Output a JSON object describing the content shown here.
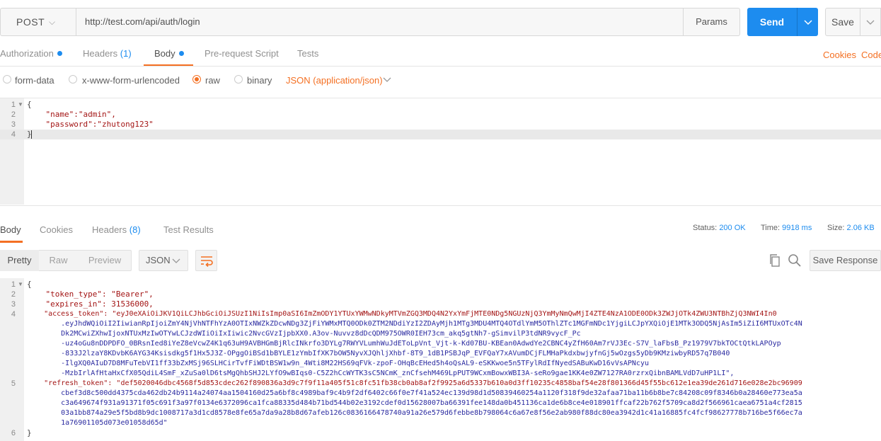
{
  "request": {
    "method": "POST",
    "url": "http://test.com/api/auth/login",
    "params_label": "Params",
    "send_label": "Send",
    "save_label": "Save"
  },
  "request_tabs": [
    {
      "label": "Authorization",
      "dot": true
    },
    {
      "label": "Headers",
      "count": "(1)"
    },
    {
      "label": "Body",
      "dot": true,
      "active": true
    },
    {
      "label": "Pre-request Script"
    },
    {
      "label": "Tests"
    }
  ],
  "links": {
    "cookies": "Cookies",
    "code": "Code"
  },
  "body_types": [
    {
      "label": "form-data",
      "selected": false
    },
    {
      "label": "x-www-form-urlencoded",
      "selected": false
    },
    {
      "label": "raw",
      "selected": true
    },
    {
      "label": "binary",
      "selected": false
    }
  ],
  "raw_format": "JSON (application/json)",
  "request_body": {
    "line_numbers": [
      "1",
      "2",
      "3",
      "4"
    ],
    "lines": [
      "{",
      "    \"name\":\"admin\",",
      "    \"password\":\"zhutong123\"",
      "}"
    ]
  },
  "response_tabs": [
    {
      "label": "Body",
      "active": true
    },
    {
      "label": "Cookies"
    },
    {
      "label": "Headers",
      "count": "(8)"
    },
    {
      "label": "Test Results"
    }
  ],
  "response_meta": {
    "status_label": "Status:",
    "status_value": "200 OK",
    "time_label": "Time:",
    "time_value": "9918 ms",
    "size_label": "Size:",
    "size_value": "2.06 KB"
  },
  "view_modes": [
    "Pretty",
    "Raw",
    "Preview"
  ],
  "response_format": "JSON",
  "save_response_label": "Save Response",
  "response_body": {
    "line_numbers": [
      "1",
      "2",
      "3",
      "4",
      "5",
      "6"
    ],
    "lines": [
      "{",
      "    \"token_type\": \"Bearer\",",
      "    \"expires_in\": 31536000,",
      "    \"access_token\": \"eyJ0eXAiOiJKV1QiLCJhbGciOiJSUzI1NiIsImp0aSI6ImZmODY1YTUxYWMwNDkyMTVmZGQ3MDQ4N2YxYmFjMTE0NDg5NGUzNjQ3YmMyNmQwMjI4ZTE4NzA1ODE0ODk3ZWJjOTk4ZWU3NTBhZjQ3NWI4In0",
      "        .eyJhdWQiOiI2IiwianRpIjoiZmY4NjVhNTFhYzA0OTIxNWZkZDcwNDg3ZjFiYWMxMTQ0ODk0ZTM2NDdiYzI2ZDAyMjh1MTg3MDU4MTQ4OTdlYmM5OThlZTc1MGFmNDc1YjgiLCJpYXQiOjE1MTk3ODQ5NjAsIm5iZiI6MTUxOTc4N",
      "        Dk2MCwiZXhwIjoxNTUxMzIwOTYwLCJzdWIiOiIxIiwic2NvcGVzIjpbXX0.A3ov-Nuvvz8dDcQDM975OWR0IEH73cm_akq5gtNh7-gSimvilP3tdNR9vycF_Pc",
      "        -uz4oGu8nDDPDFO_0BRsnIed8iYeZ8eVcwZ4K1q63uH9AVBHGmBjRlcINkrfo3DYLg7RWYVLumhWuJdEToLpVnt_Vjt-k-Kd07BU-KBEan0AdwdYe2CBNC4yZfH60Am7rVJ3Ec-S7V_laFbsB_Pz1979V7bkTOCtQtkLAPOyp",
      "        -833J2lzaY8KDvbK6AYG34Ksisdkg5f1Hx5J3Z-OPggOiBSd1bBYLE1zYmbIfXK7bOW5NyvXJQhljXhbf-8T9_1dB1PSBJqP_EVFQaY7xAVumDCjFLMHaPkdxbwjyfnGj5wOzgs5yDb9KMziwbyRD57q7B040",
      "        -IlgXQ0AIuD7D8MFuTebVI1ff33bZxMSj96SLHCirTvfFiWDtBSW1w9n_4Wti8M22HS69qFVk-zpoF-OHqBcEHed5h4oQsAL9-eSKKwoe5n5TFylRdIfNyedSABuKwD16vVsAPNcyu",
      "        -MzbIrlAfHtaHxCfX05QdiL4SmF_xZuSa0lD6tsMgQhbSHJ2LYfO9wBIqs0-C5Z2hCcWYTK3sC5NCmK_znCfsehM469LpPUT9WCxmBowxWBI3A-seRo9gae1KK4e0ZW7127RA0rzrxQibnBAMLVdD7uHP1LI\",",
      "    \"refresh_token\": \"def5020046dbc4568f5d853cdec262f890836a3d9c7f9f11a405f51c8fc51fb38cb0ab8af2f9925a6d5337b610a0d3ff10235c4858baf54e28f801366d45f55bc612e1ea39de261d716e028e2bc96909",
      "        cbef3d8c500dd4375cda462db24b9114a24074aa1504160d25a6bf8c4989baf9c4b9f2df6402c66f0e7f41a524ec139d98d1d50839460254a1120f318f9de32afaa71ba11b6b8be7c84208c09f8346b0a28460e773ea5a",
      "        c3a649674f931a91371f05c691f3a97f0134e6372096ca1fca88335d484b71bd544b02e3192cdef0d15628007ba66391fee148da0b451136ca1de6b8ce4e018901ffcaf22b762f5709ca8d2f566961caea6751a4cf2815",
      "        03a1bb874a29e5f5bd8b9dc1008717a3d1cd8578e8fe65a7da9a28b8d67afeb126c0836166478740a91a26e579d6febbe8b798064c6a67e8f56e2ab980f88dc80ea3942d1c41a16885fc4fcf98627778b716be5f66ec7a",
      "        1a76901105d073e01058d65d\"",
      "}"
    ]
  },
  "icons": [
    "chevron-down-icon",
    "wrap-lines-icon",
    "copy-icon",
    "search-icon"
  ],
  "colors": {
    "accent": "#f47023",
    "send": "#1d8cef"
  }
}
